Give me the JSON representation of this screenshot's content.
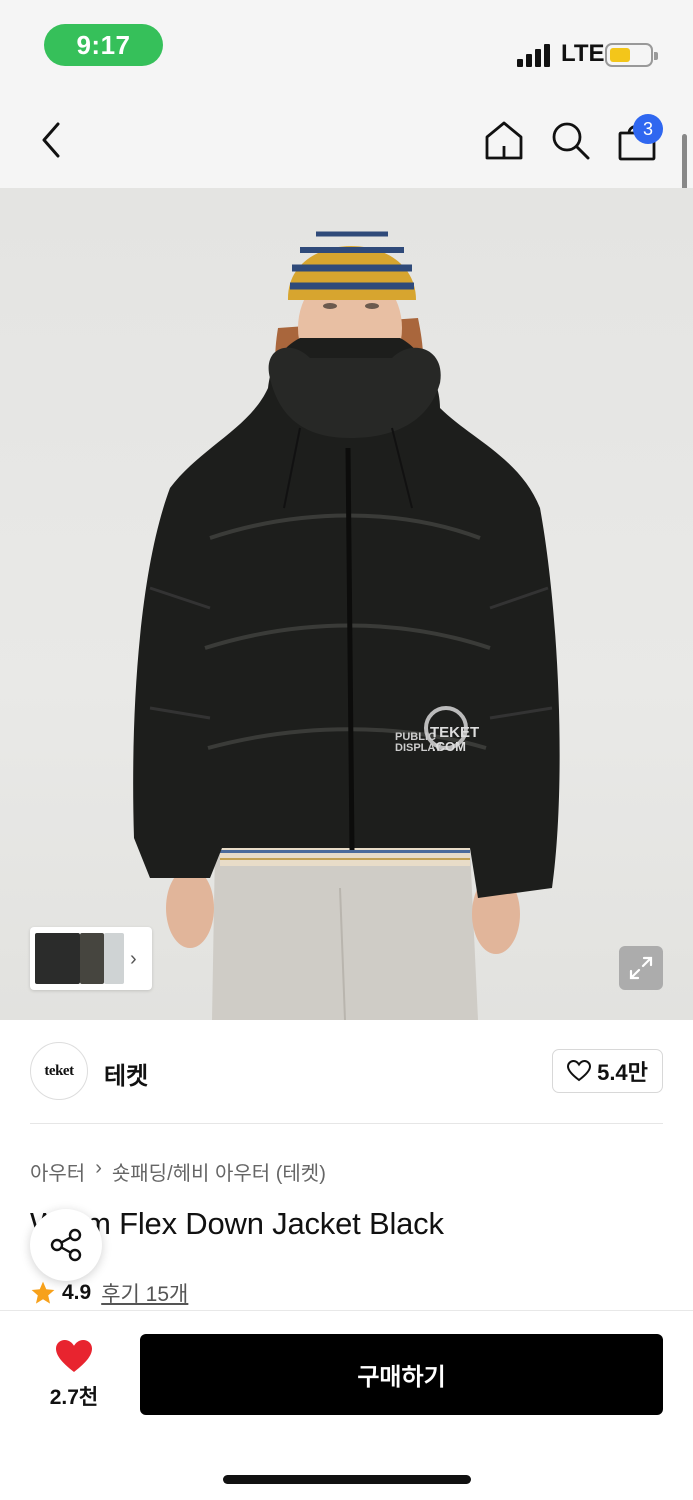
{
  "status_bar": {
    "time": "9:17",
    "network": "LTE",
    "battery_level": 0.5,
    "battery_color": "#f3c61a"
  },
  "nav": {
    "cart_count": "3",
    "icons": [
      "back-icon",
      "home-icon",
      "search-icon",
      "bag-icon"
    ]
  },
  "gallery": {
    "thumb_next": "›"
  },
  "brand": {
    "logo_text": "teket",
    "name": "테켓",
    "likes": "5.4만"
  },
  "product": {
    "breadcrumb": [
      "아우터",
      "›",
      "숏패딩/헤비 아우터 (테켓)"
    ],
    "title": "Warm Flex Down Jacket Black",
    "rating": "4.9",
    "reviews": "후기 15개"
  },
  "bottom": {
    "wish_count": "2.7천",
    "buy_label": "구매하기"
  },
  "colors": {
    "accent": "#2f67f0",
    "status_green": "#36c05a",
    "heart": "#e8242f",
    "star": "#f7a11b"
  }
}
